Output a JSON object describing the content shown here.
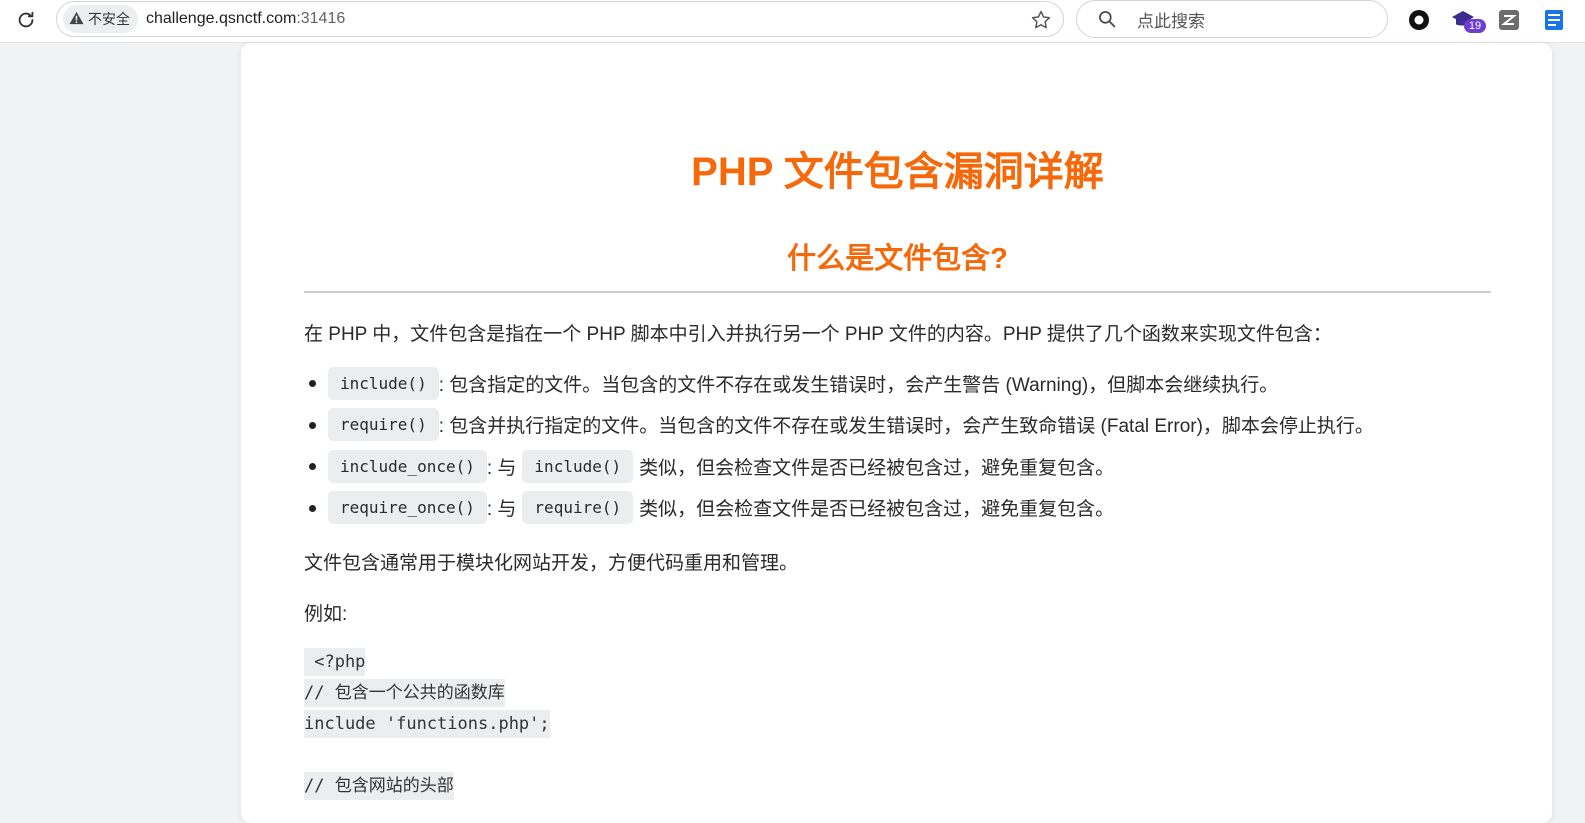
{
  "browser": {
    "security_label": "不安全",
    "url_host": "challenge.qsnctf.com",
    "url_port": ":31416",
    "search_placeholder": "点此搜索",
    "extension_badge_count": "19",
    "icons": [
      "reload-icon",
      "warning-icon",
      "star-icon",
      "search-icon",
      "circle-extension-icon",
      "cap-extension-icon",
      "z-extension-icon",
      "blue-extension-icon"
    ]
  },
  "page": {
    "title": "PHP 文件包含漏洞详解",
    "section_title": "什么是文件包含?",
    "intro": "在 PHP 中，文件包含是指在一个 PHP 脚本中引入并执行另一个 PHP 文件的内容。PHP 提供了几个函数来实现文件包含：",
    "functions": [
      {
        "code": "include()",
        "desc": ": 包含指定的文件。当包含的文件不存在或发生错误时，会产生警告 (Warning)，但脚本会继续执行。"
      },
      {
        "code": "require()",
        "desc": ": 包含并执行指定的文件。当包含的文件不存在或发生错误时，会产生致命错误 (Fatal Error)，脚本会停止执行。"
      },
      {
        "code": "include_once()",
        "mid": ": 与",
        "ref": "include()",
        "desc": "类似，但会检查文件是否已经被包含过，避免重复包含。"
      },
      {
        "code": "require_once()",
        "mid": ": 与",
        "ref": "require()",
        "desc": "类似，但会检查文件是否已经被包含过，避免重复包含。"
      }
    ],
    "usage": "文件包含通常用于模块化网站开发，方便代码重用和管理。",
    "example_label": "例如:",
    "code_lines": [
      " <?php",
      "// 包含一个公共的函数库",
      "include 'functions.php';",
      "",
      "// 包含网站的头部"
    ]
  },
  "colors": {
    "heading_orange": "#f5690a",
    "code_bg": "#ecedee",
    "page_bg": "#f1f2f4"
  }
}
